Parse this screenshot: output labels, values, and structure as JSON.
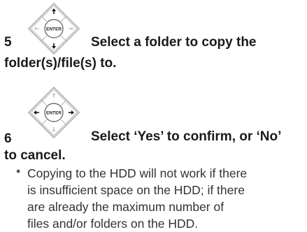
{
  "steps": [
    {
      "number": "5",
      "title_line1": "Select a folder to copy the",
      "title_line2": "folder(s)/file(s) to.",
      "icon": "remote-dpad-up-down-icon",
      "center_label": "ENTER"
    },
    {
      "number": "6",
      "title_line1": "Select ‘Yes’ to confirm, or ‘No’",
      "title_line2": "to cancel.",
      "icon": "remote-dpad-left-right-icon",
      "center_label": "ENTER"
    }
  ],
  "note": {
    "bullet": "•",
    "lines": [
      "Copying to the HDD will not work if there",
      "is insufficient space on the HDD; if there",
      "are already the maximum number of",
      "files and/or folders on the HDD."
    ]
  }
}
